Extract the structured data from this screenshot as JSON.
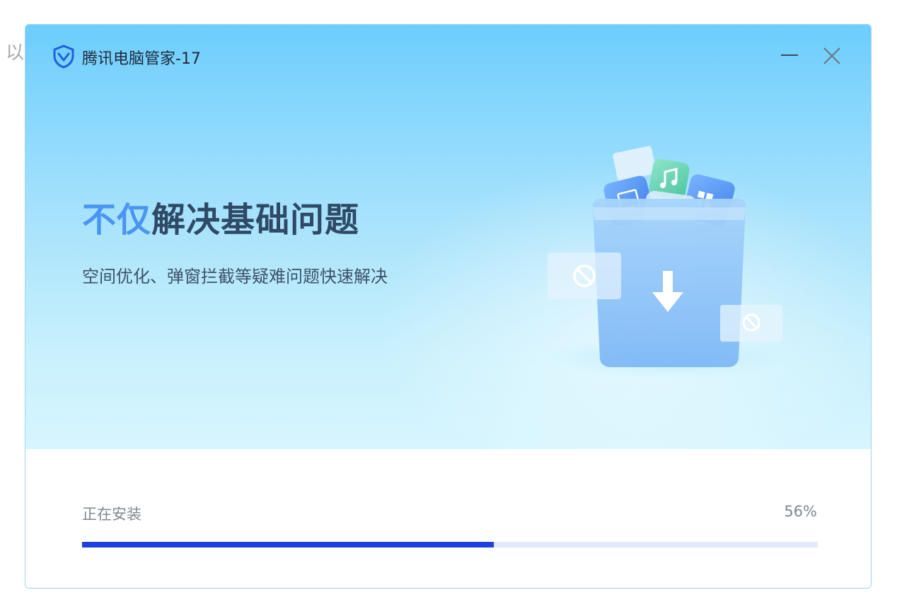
{
  "background": {
    "partial_text": "以"
  },
  "window": {
    "title": "腾讯电脑管家-17",
    "icons": {
      "logo": "shield-logo-icon",
      "minimize": "minimize-icon",
      "close": "close-icon"
    }
  },
  "hero": {
    "headline_accent": "不仅",
    "headline_main": "解决基础问题",
    "subline": "空间优化、弹窗拦截等疑难问题快速解决",
    "illustration_icons": [
      "trash-bin-icon",
      "download-arrow-icon",
      "image-icon",
      "music-icon",
      "windows-icon",
      "blocked-icon"
    ]
  },
  "install": {
    "status_label": "正在安装",
    "percent_text": "56%",
    "progress": 0.56
  },
  "colors": {
    "accent": "#4a95f0",
    "progress_fill": "#1e40e0",
    "progress_track": "#dfe9fb",
    "hero_top": "#6ccdfd",
    "hero_bottom": "#d7f5fe"
  }
}
